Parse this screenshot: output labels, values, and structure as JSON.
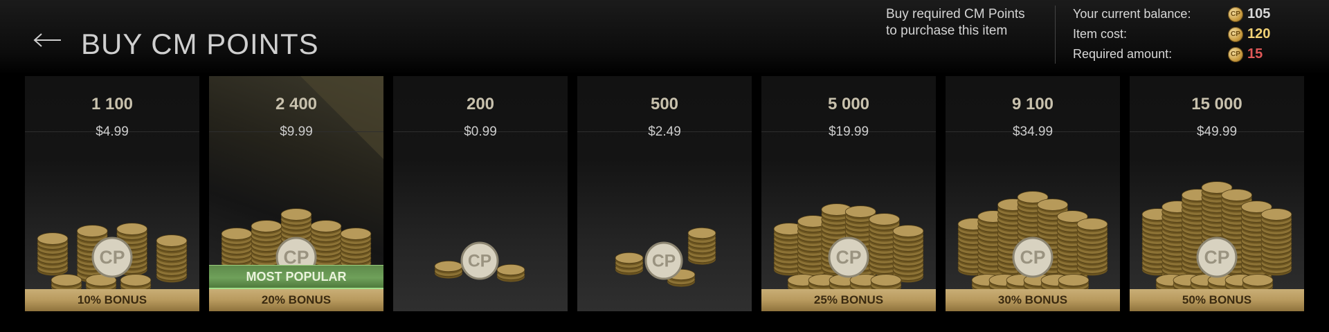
{
  "header": {
    "title": "BUY CM POINTS",
    "notice_line1": "Buy required CM Points",
    "notice_line2": "to purchase this item"
  },
  "summary": {
    "balance_label": "Your current balance:",
    "balance_value": "105",
    "cost_label": "Item cost:",
    "cost_value": "120",
    "required_label": "Required amount:",
    "required_value": "15",
    "colors": {
      "balance": "#d8d8d8",
      "cost": "#f2d276",
      "required": "#e05858"
    }
  },
  "packs": [
    {
      "points": "1 100",
      "price": "$4.99",
      "bonus": "10% BONUS",
      "coins": 3
    },
    {
      "points": "2 400",
      "price": "$9.99",
      "bonus": "20% BONUS",
      "badge": "MOST POPULAR",
      "coins": 4
    },
    {
      "points": "200",
      "price": "$0.99",
      "bonus": "",
      "coins": 1
    },
    {
      "points": "500",
      "price": "$2.49",
      "bonus": "",
      "coins": 2
    },
    {
      "points": "5 000",
      "price": "$19.99",
      "bonus": "25% BONUS",
      "coins": 5
    },
    {
      "points": "9 100",
      "price": "$34.99",
      "bonus": "30% BONUS",
      "coins": 6
    },
    {
      "points": "15 000",
      "price": "$49.99",
      "bonus": "50% BONUS",
      "coins": 7
    }
  ],
  "icons": {
    "back": "back-arrow-icon",
    "currency": "cp-coin-icon",
    "art": "coin-stack-icon"
  }
}
